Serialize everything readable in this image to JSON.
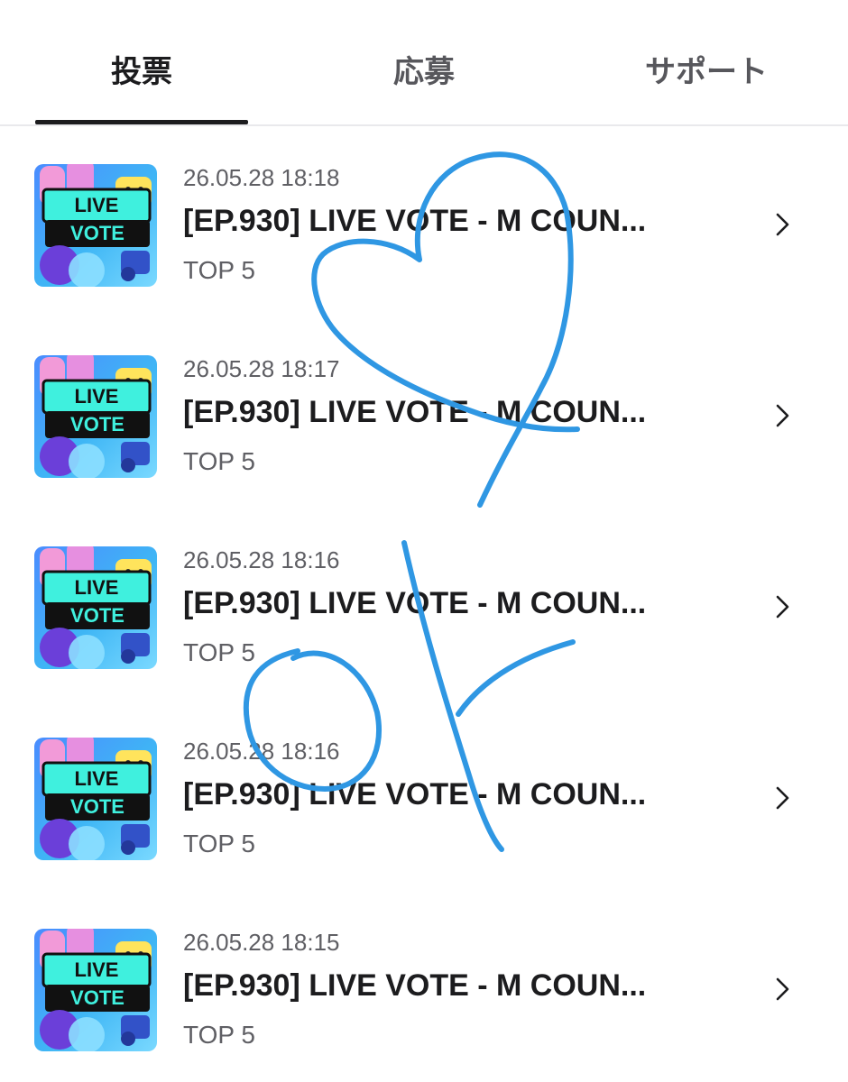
{
  "tabs": [
    {
      "label": "投票",
      "active": true
    },
    {
      "label": "応募",
      "active": false
    },
    {
      "label": "サポート",
      "active": false
    }
  ],
  "thumbnail": {
    "line1": "LIVE",
    "line2": "VOTE"
  },
  "votes": [
    {
      "date": "26.05.28 18:18",
      "title": "[EP.930] LIVE VOTE - M COUN...",
      "subtitle": "TOP 5"
    },
    {
      "date": "26.05.28 18:17",
      "title": "[EP.930] LIVE VOTE - M COUN...",
      "subtitle": "TOP 5"
    },
    {
      "date": "26.05.28 18:16",
      "title": "[EP.930] LIVE VOTE - M COUN...",
      "subtitle": "TOP 5"
    },
    {
      "date": "26.05.28 18:16",
      "title": "[EP.930] LIVE VOTE - M COUN...",
      "subtitle": "TOP 5"
    },
    {
      "date": "26.05.28 18:15",
      "title": "[EP.930] LIVE VOTE - M COUN...",
      "subtitle": "TOP 5"
    }
  ],
  "icons": {
    "row_arrow": "chevron-right-icon"
  },
  "colors": {
    "text_primary": "#1c1c1e",
    "text_secondary": "#5f5f64",
    "divider": "#e9e9ec",
    "doodle_stroke": "#2f97e3",
    "thumb_banner": "#3ff0de"
  }
}
